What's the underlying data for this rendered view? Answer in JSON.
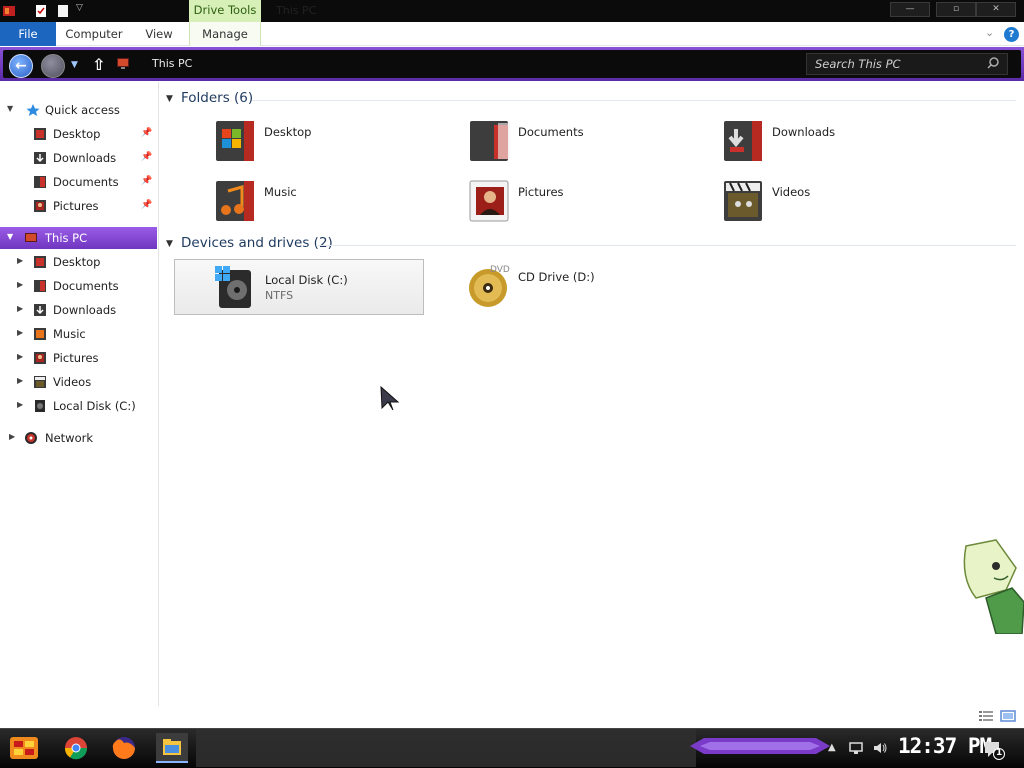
{
  "titlebar": {
    "context_tab": "Drive Tools",
    "window_title": "This PC",
    "minimize": "—",
    "maximize": "▫",
    "close": "✕"
  },
  "ribbon": {
    "tabs": [
      "File",
      "Computer",
      "View",
      "Manage"
    ]
  },
  "address": {
    "path": "This PC",
    "search_placeholder": "Search This PC"
  },
  "nav": {
    "quick_access": {
      "label": "Quick access",
      "items": [
        "Desktop",
        "Downloads",
        "Documents",
        "Pictures"
      ]
    },
    "this_pc": {
      "label": "This PC",
      "items": [
        "Desktop",
        "Documents",
        "Downloads",
        "Music",
        "Pictures",
        "Videos",
        "Local Disk (C:)"
      ]
    },
    "network": {
      "label": "Network"
    }
  },
  "content": {
    "folders_title": "Folders (6)",
    "folders": [
      "Desktop",
      "Documents",
      "Downloads",
      "Music",
      "Pictures",
      "Videos"
    ],
    "devices_title": "Devices and drives (2)",
    "drives": [
      {
        "name": "Local Disk (C:)",
        "fs": "NTFS"
      },
      {
        "name": "CD Drive (D:)"
      }
    ]
  },
  "taskbar": {
    "clock": "12:37 PM",
    "notification_count": "1",
    "apps": [
      "chrome-icon",
      "firefox-icon",
      "file-explorer-icon"
    ]
  },
  "colors": {
    "accent_purple": "#7a44cc",
    "file_tab": "#1c66c0",
    "drive_tools": "#d6f0b8"
  }
}
